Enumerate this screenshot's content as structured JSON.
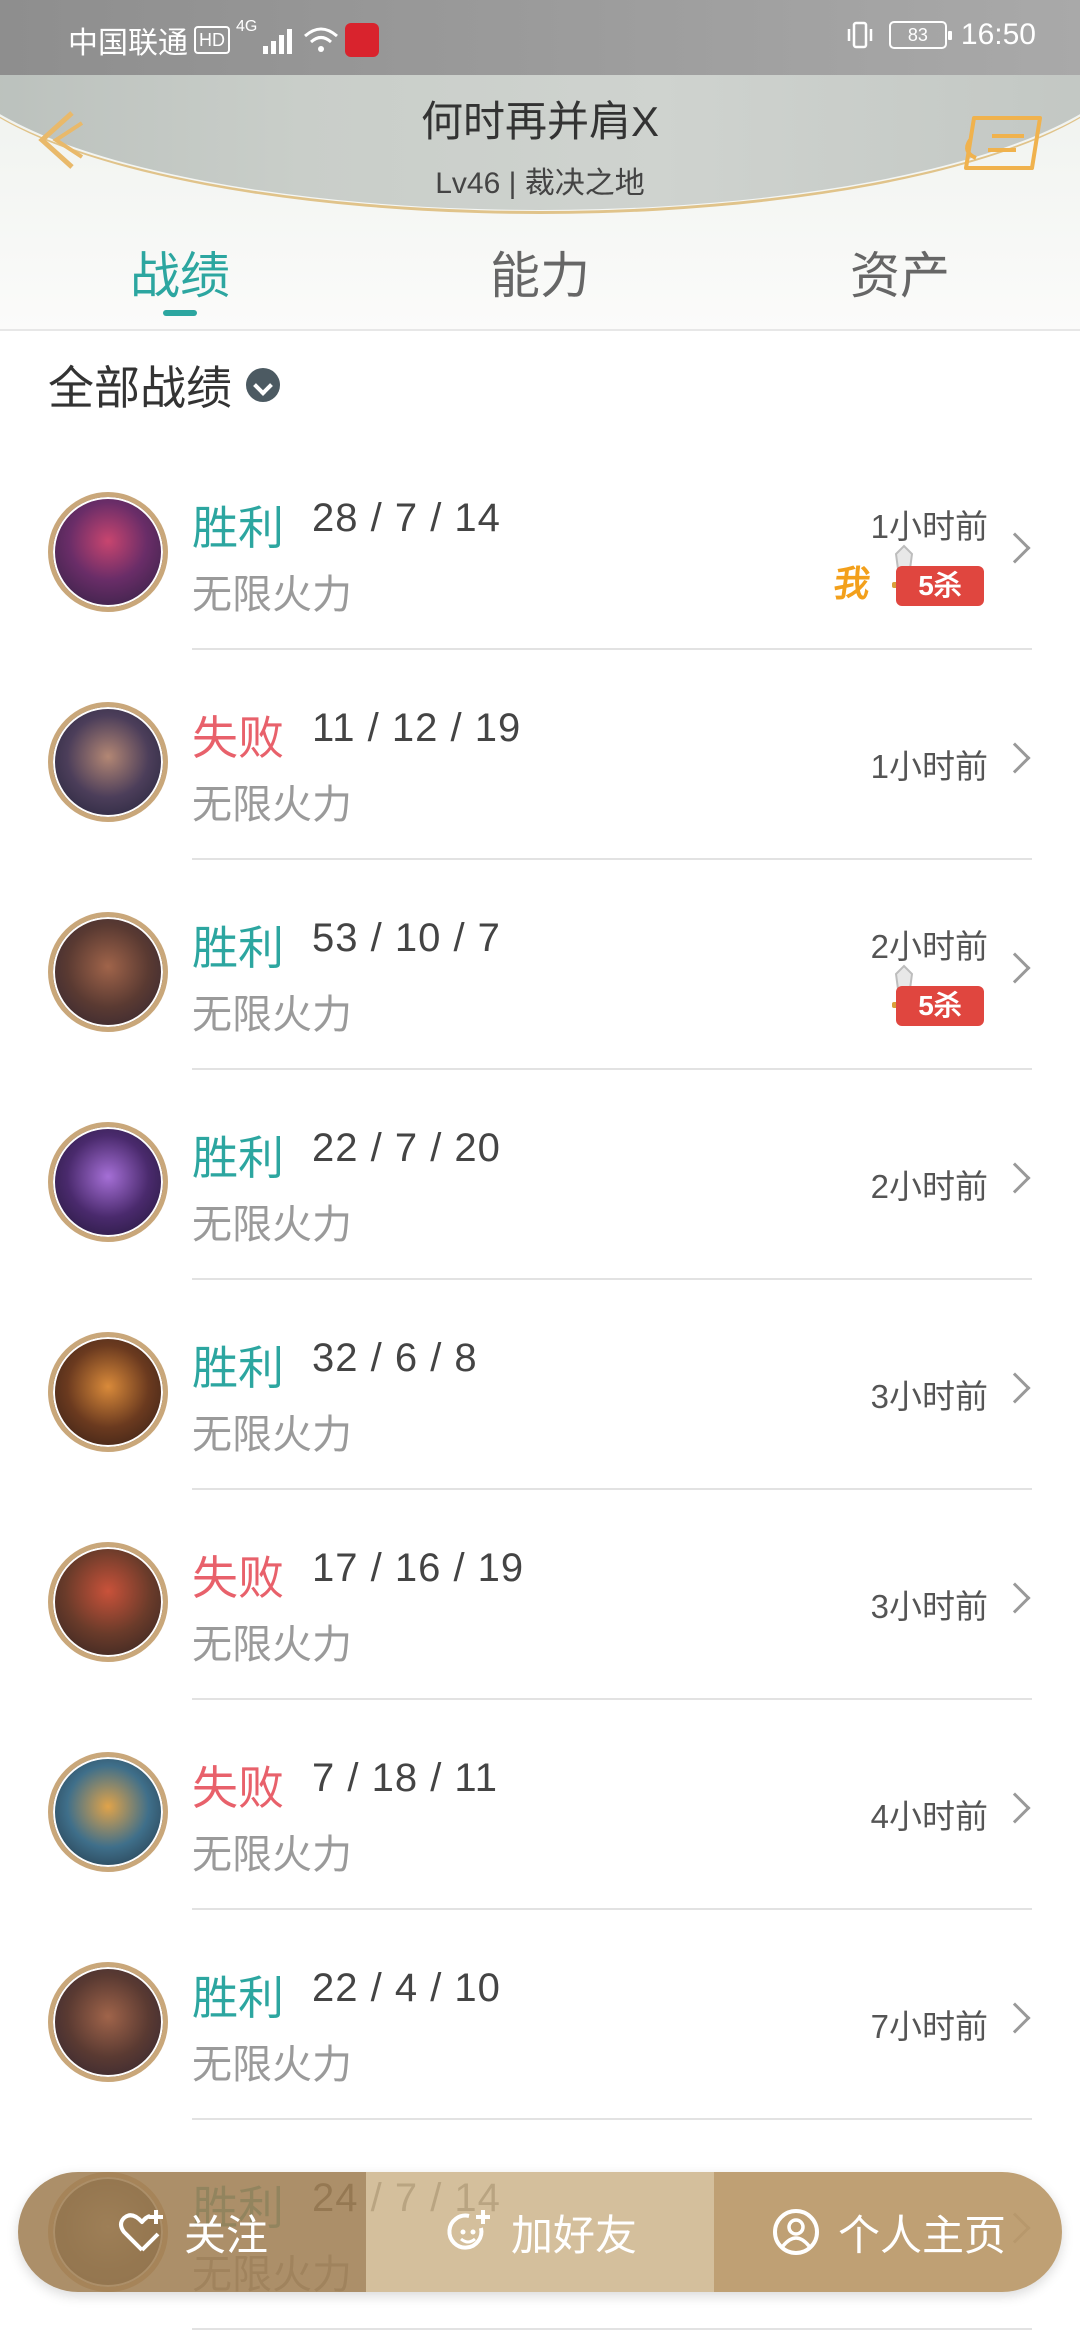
{
  "status_bar": {
    "carrier": "中国联通",
    "hd": "HD",
    "network": "4G",
    "battery": "83",
    "time": "16:50"
  },
  "profile": {
    "name": "何时再并肩X",
    "subtitle": "Lv46 | 裁决之地"
  },
  "tabs": [
    {
      "label": "战绩",
      "active": true
    },
    {
      "label": "能力",
      "active": false
    },
    {
      "label": "资产",
      "active": false
    }
  ],
  "filter": {
    "label": "全部战绩"
  },
  "matches": [
    {
      "result": "胜利",
      "kda": "28 / 7 / 14",
      "mode": "无限火力",
      "time": "1小时前",
      "me": "我",
      "penta": "5杀"
    },
    {
      "result": "失败",
      "kda": "11 / 12 / 19",
      "mode": "无限火力",
      "time": "1小时前"
    },
    {
      "result": "胜利",
      "kda": "53 / 10 / 7",
      "mode": "无限火力",
      "time": "2小时前",
      "penta": "5杀"
    },
    {
      "result": "胜利",
      "kda": "22 / 7 / 20",
      "mode": "无限火力",
      "time": "2小时前"
    },
    {
      "result": "胜利",
      "kda": "32 / 6 / 8",
      "mode": "无限火力",
      "time": "3小时前"
    },
    {
      "result": "失败",
      "kda": "17 / 16 / 19",
      "mode": "无限火力",
      "time": "3小时前"
    },
    {
      "result": "失败",
      "kda": "7 / 18 / 11",
      "mode": "无限火力",
      "time": "4小时前"
    },
    {
      "result": "胜利",
      "kda": "22 / 4 / 10",
      "mode": "无限火力",
      "time": "7小时前"
    },
    {
      "result": "胜利",
      "kda": "24 / 7 / 14",
      "mode": "无限火力",
      "time": ""
    }
  ],
  "actions": {
    "follow": "关注",
    "add_friend": "加好友",
    "homepage": "个人主页"
  },
  "colors": {
    "accent": "#2ca6a0",
    "lose": "#e8616b",
    "gold": "#c9a77a"
  }
}
